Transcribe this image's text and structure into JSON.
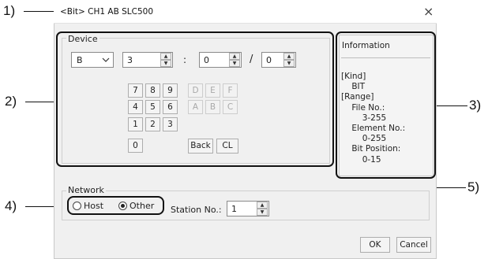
{
  "callouts": [
    "1)",
    "2)",
    "3)",
    "4)",
    "5)"
  ],
  "dialog": {
    "title": "<Bit> CH1 AB SLC500",
    "close_glyph": "×"
  },
  "device": {
    "group_label": "Device",
    "type_value": "B",
    "file_value": "3",
    "sep1": ":",
    "element_value": "0",
    "sep2": "/",
    "bit_value": "0",
    "keypad": {
      "digits": [
        "7",
        "8",
        "9",
        "4",
        "5",
        "6",
        "1",
        "2",
        "3",
        "0"
      ],
      "hex": [
        "D",
        "E",
        "F",
        "A",
        "B",
        "C"
      ],
      "back_label": "Back",
      "clear_label": "CL"
    }
  },
  "information": {
    "title": "Information",
    "body": "[Kind]\n    BIT\n[Range]\n    File No.:\n        3-255\n    Element No.:\n        0-255\n    Bit Position:\n        0-15"
  },
  "network": {
    "group_label": "Network",
    "host_label": "Host",
    "other_label": "Other",
    "selected": "Other",
    "station_label": "Station No.:",
    "station_value": "1"
  },
  "buttons": {
    "ok": "OK",
    "cancel": "Cancel"
  }
}
